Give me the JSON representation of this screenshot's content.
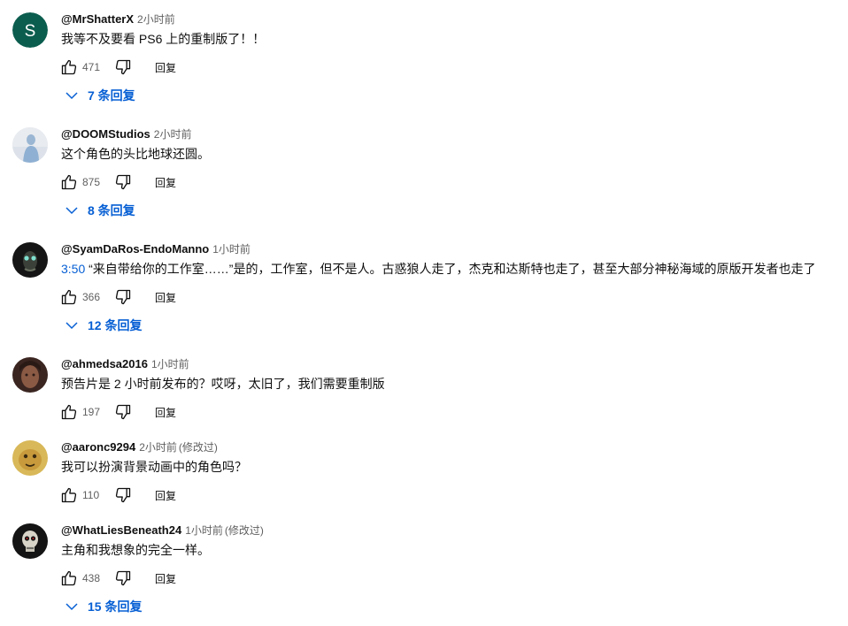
{
  "comments": [
    {
      "author": "@MrShatterX",
      "time": "2小时前",
      "edited": "",
      "timestamp_link": "",
      "text": "我等不及要看 PS6 上的重制版了！！",
      "likes": "471",
      "reply_label": "回复",
      "replies": "7 条回复",
      "avatar_letter": "S",
      "avatar_color": "#0b5d4e"
    },
    {
      "author": "@DOOMStudios",
      "time": "2小时前",
      "edited": "",
      "timestamp_link": "",
      "text": "这个角色的头比地球还圆。",
      "likes": "875",
      "reply_label": "回复",
      "replies": "8 条回复",
      "avatar_color": "#d9dde3"
    },
    {
      "author": "@SyamDaRos-EndoManno",
      "time": "1小时前",
      "edited": "",
      "timestamp_link": "3:50",
      "text": " “来自带给你的工作室……”是的，工作室，但不是人。古惑狼人走了，杰克和达斯特也走了，甚至大部分神秘海域的原版开发者也走了",
      "likes": "366",
      "reply_label": "回复",
      "replies": "12 条回复",
      "avatar_color": "#1a1a1a"
    },
    {
      "author": "@ahmedsa2016",
      "time": "1小时前",
      "edited": "",
      "timestamp_link": "",
      "text": "预告片是 2 小时前发布的？哎呀，太旧了，我们需要重制版",
      "likes": "197",
      "reply_label": "回复",
      "replies": "",
      "avatar_color": "#5a3a30"
    },
    {
      "author": "@aaronc9294",
      "time": "2小时前",
      "edited": "(修改过)",
      "timestamp_link": "",
      "text": "我可以扮演背景动画中的角色吗？",
      "likes": "110",
      "reply_label": "回复",
      "replies": "",
      "avatar_color": "#c9a640"
    },
    {
      "author": "@WhatLiesBeneath24",
      "time": "1小时前",
      "edited": "(修改过)",
      "timestamp_link": "",
      "text": "主角和我想象的完全一样。",
      "likes": "438",
      "reply_label": "回复",
      "replies": "15 条回复",
      "avatar_color": "#1b1b1b"
    }
  ]
}
